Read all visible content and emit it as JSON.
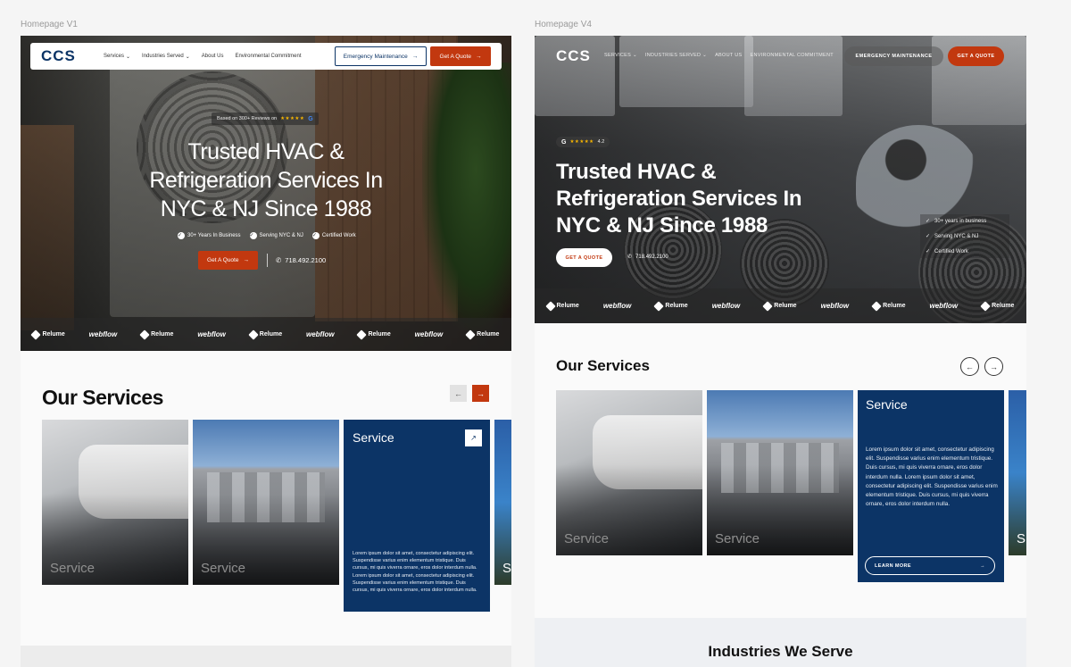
{
  "frames": {
    "v1_label": "Homepage V1",
    "v4_label": "Homepage V4"
  },
  "v1": {
    "nav": {
      "logo": "CCS",
      "links": [
        "Services",
        "Industries Served",
        "About Us",
        "Environmental Commitment"
      ],
      "emergency_label": "Emergency Maintenance",
      "quote_label": "Get A Quote"
    },
    "hero": {
      "review_text": "Based on 300+ Reviews on",
      "stars": "★★★★★",
      "title": "Trusted HVAC & Refrigeration Services In NYC & NJ Since 1988",
      "features": [
        "30+ Years In Business",
        "Serving NYC & NJ",
        "Certified Work"
      ],
      "cta_label": "Get A Quote",
      "phone": "718.492.2100"
    },
    "logos": [
      "Relume",
      "webflow",
      "Relume",
      "webflow",
      "Relume",
      "webflow",
      "Relume",
      "webflow",
      "Relume"
    ],
    "services": {
      "title": "Our Services",
      "cards": [
        {
          "label": "Service"
        },
        {
          "label": "Service"
        },
        {
          "title": "Service",
          "description": "Lorem ipsum dolor sit amet, consectetur adipiscing elit. Suspendisse varius enim elementum tristique. Duis cursus, mi quis viverra ornare, eros dolor interdum nulla. Lorem ipsum dolor sit amet, consectetur adipiscing elit. Suspendisse varius enim elementum tristique. Duis cursus, mi quis viverra ornare, eros dolor interdum nulla."
        },
        {
          "label": "S"
        }
      ]
    }
  },
  "v4": {
    "nav": {
      "logo": "CCS",
      "links": [
        "SERVICES",
        "INDUSTRIES SERVED",
        "ABOUT US",
        "ENVIRONMENTAL COMMITMENT"
      ],
      "emergency_label": "EMERGENCY MAINTENANCE",
      "quote_label": "GET A QUOTE"
    },
    "hero": {
      "rating": "4.2",
      "stars": "★★★★★",
      "title": "Trusted HVAC & Refrigeration Services In NYC & NJ Since 1988",
      "features": [
        "30+ years in business",
        "Serving NYC & NJ",
        "Certified Work"
      ],
      "cta_label": "GET A QUOTE",
      "phone": "718.492.2100"
    },
    "logos": [
      "Relume",
      "webflow",
      "Relume",
      "webflow",
      "Relume",
      "webflow",
      "Relume",
      "webflow",
      "Relume"
    ],
    "services": {
      "title": "Our Services",
      "cards": [
        {
          "label": "Service"
        },
        {
          "label": "Service"
        },
        {
          "title": "Service",
          "description": "Lorem ipsum dolor sit amet, consectetur adipiscing elit. Suspendisse varius enim elementum tristique. Duis cursus, mi quis viverra ornare, eros dolor interdum nulla. Lorem ipsum dolor sit amet, consectetur adipiscing elit. Suspendisse varius enim elementum tristique. Duis cursus, mi quis viverra ornare, eros dolor interdum nulla.",
          "learn_more": "LEARN MORE"
        },
        {
          "label": "S"
        }
      ]
    },
    "industries_title": "Industries We Serve"
  },
  "colors": {
    "brand_navy": "#0c3466",
    "accent_orange": "#c2380f"
  }
}
